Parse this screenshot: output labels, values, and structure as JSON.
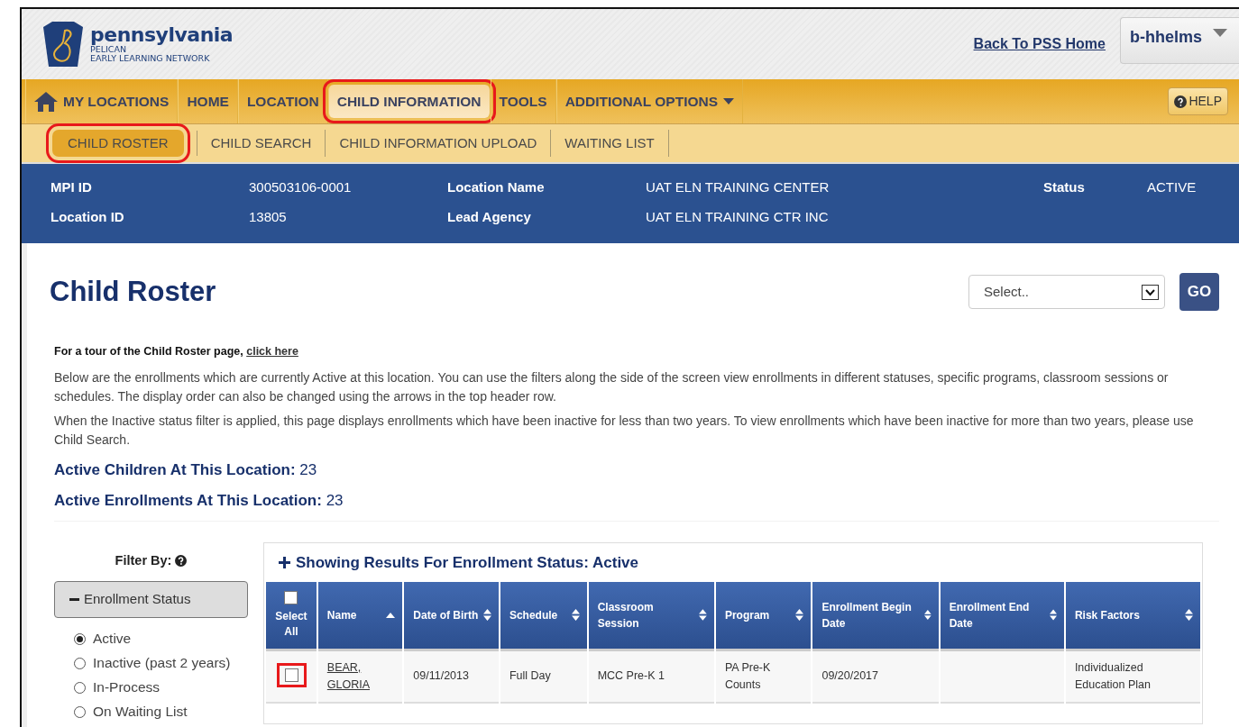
{
  "header": {
    "logo_title": "pennsylvania",
    "logo_lines": [
      "PELICAN",
      "EARLY LEARNING NETWORK"
    ],
    "back_link": "Back To PSS Home",
    "user_menu": "b-hhelms"
  },
  "main_nav": [
    {
      "label": "MY LOCATIONS",
      "kind": "home",
      "selected": false,
      "annotated": false
    },
    {
      "label": "HOME",
      "kind": "plain",
      "selected": false,
      "annotated": false
    },
    {
      "label": "LOCATION",
      "kind": "plain",
      "selected": false,
      "annotated": false
    },
    {
      "label": "CHILD INFORMATION",
      "kind": "plain",
      "selected": true,
      "annotated": true
    },
    {
      "label": "TOOLS",
      "kind": "plain",
      "selected": false,
      "annotated": false
    },
    {
      "label": "ADDITIONAL OPTIONS",
      "kind": "dropdown",
      "selected": false,
      "annotated": false
    }
  ],
  "help_button": "HELP",
  "sub_nav": [
    {
      "label": "CHILD ROSTER",
      "selected": true,
      "annotated": true
    },
    {
      "label": "CHILD SEARCH",
      "selected": false,
      "annotated": false
    },
    {
      "label": "CHILD INFORMATION UPLOAD",
      "selected": false,
      "annotated": false
    },
    {
      "label": "WAITING LIST",
      "selected": false,
      "annotated": false
    }
  ],
  "info_rows": [
    [
      {
        "label": "MPI ID",
        "value": "300503106-0001"
      },
      {
        "label": "Location Name",
        "value": "UAT ELN TRAINING CENTER"
      },
      {
        "label": "Status",
        "value": "ACTIVE"
      }
    ],
    [
      {
        "label": "Location ID",
        "value": "13805"
      },
      {
        "label": "Lead Agency",
        "value": "UAT ELN TRAINING CTR INC"
      }
    ]
  ],
  "page_title": "Child Roster",
  "action_select": {
    "value": "Select.."
  },
  "go_button": "GO",
  "tour": {
    "text": "For a tour of the Child Roster page,",
    "link": "click here"
  },
  "paragraphs": [
    "Below are the enrollments which are currently Active at this location. You can use the filters along the side of the screen view enrollments in different statuses, specific programs, classroom sessions or schedules. The display order can also be changed using the arrows in the top header row.",
    "When the Inactive status filter is applied, this page displays enrollments which have been inactive for less than two years. To view enrollments which have been inactive for more than two years, please use Child Search."
  ],
  "counts": [
    {
      "label": "Active Children At This Location:",
      "value": "23"
    },
    {
      "label": "Active Enrollments At This Location:",
      "value": "23"
    }
  ],
  "filter": {
    "title": "Filter By:",
    "section": "Enrollment Status",
    "expanded": true,
    "options": [
      {
        "label": "Active",
        "selected": true
      },
      {
        "label": "Inactive (past 2 years)",
        "selected": false
      },
      {
        "label": "In-Process",
        "selected": false
      },
      {
        "label": "On Waiting List",
        "selected": false
      }
    ]
  },
  "results_title": "Showing Results For Enrollment Status: Active",
  "table": {
    "columns": [
      {
        "label": "Select All",
        "kind": "select",
        "checked": false
      },
      {
        "label": "Name",
        "kind": "sort",
        "sorted": true
      },
      {
        "label": "Date of Birth",
        "kind": "sort",
        "sorted": false
      },
      {
        "label": "Schedule",
        "kind": "sort",
        "sorted": false
      },
      {
        "label": "Classroom Session",
        "kind": "sort",
        "sorted": false
      },
      {
        "label": "Program",
        "kind": "sort",
        "sorted": false
      },
      {
        "label": "Enrollment Begin Date",
        "kind": "sort",
        "sorted": false
      },
      {
        "label": "Enrollment End Date",
        "kind": "sort",
        "sorted": false
      },
      {
        "label": "Risk Factors",
        "kind": "sort",
        "sorted": false
      }
    ],
    "rows": [
      {
        "selected": false,
        "annotated": true,
        "cells": [
          "",
          "BEAR, GLORIA",
          "09/11/2013",
          "Full Day",
          "MCC Pre-K 1",
          "PA Pre-K Counts",
          "09/20/2017",
          "",
          "Individualized Education Plan"
        ]
      }
    ]
  }
}
